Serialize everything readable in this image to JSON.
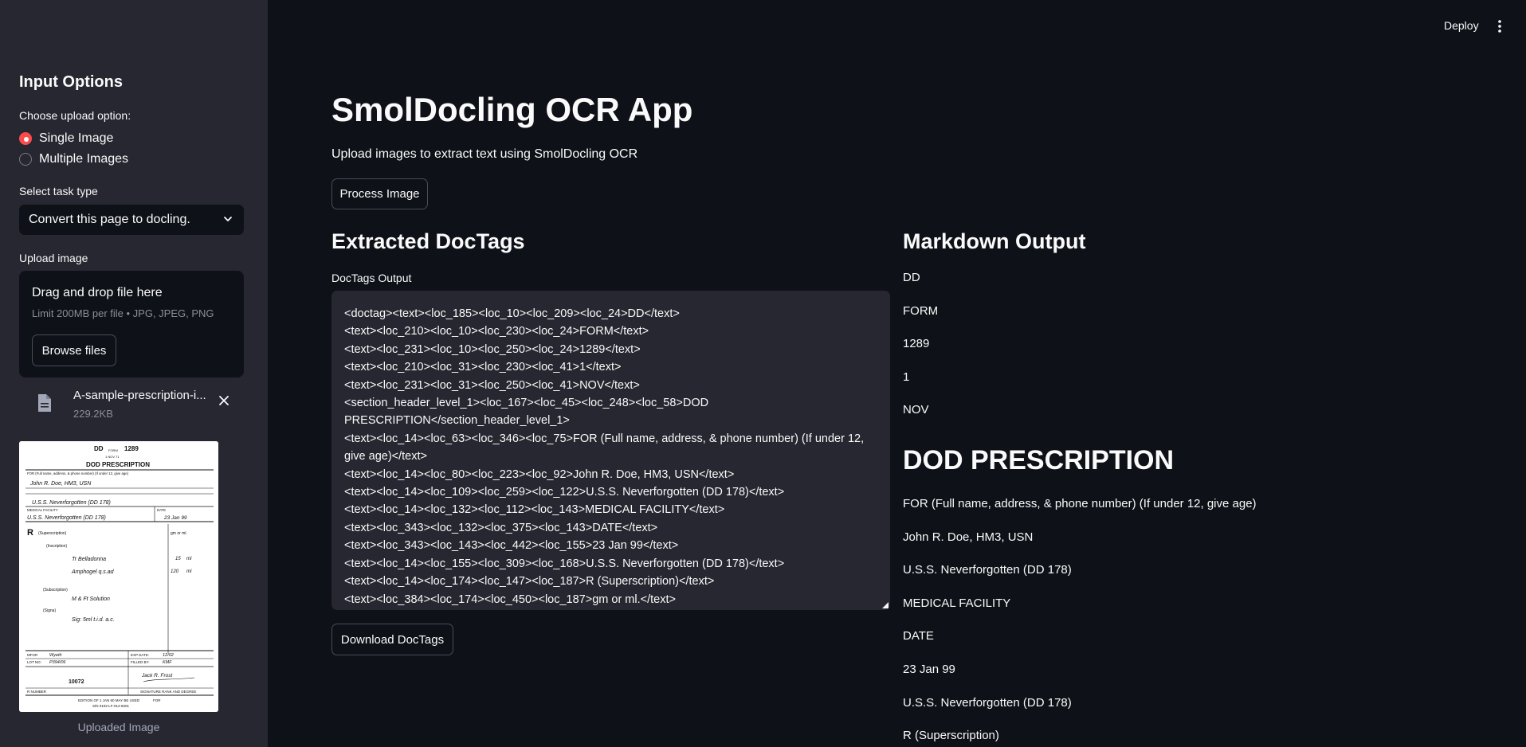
{
  "header": {
    "deploy_label": "Deploy",
    "menu_icon": "kebab-menu-icon"
  },
  "sidebar": {
    "heading": "Input Options",
    "upload_option_label": "Choose upload option:",
    "upload_options": [
      {
        "label": "Single Image",
        "selected": true
      },
      {
        "label": "Multiple Images",
        "selected": false
      }
    ],
    "task_type_label": "Select task type",
    "task_type_value": "Convert this page to docling.",
    "upload_label": "Upload image",
    "dropzone_title": "Drag and drop file here",
    "dropzone_limit": "Limit 200MB per file • JPG, JPEG, PNG",
    "browse_label": "Browse files",
    "file_name": "A-sample-prescription-i...",
    "file_size": "229.2KB",
    "image_caption": "Uploaded Image",
    "accent_color": "#ff4b4b",
    "thumbnail": {
      "form_no": "DD",
      "form_label": "FORM",
      "form_num": "1289",
      "date_line": "1 NOV 71",
      "title": "DOD PRESCRIPTION",
      "for_label": "FOR (Full name, address, & phone number) (If under 12, give age)",
      "name": "John R. Doe, HM3, USN",
      "ship": "U.S.S. Neverforgotten (DD 178)",
      "facility_label": "MEDICAL FACILITY",
      "date_label": "DATE",
      "facility": "U.S.S. Neverforgotten (DD 178)",
      "date": "23 Jan 99",
      "rx": "R",
      "superscription": "(Superscription)",
      "gm_ml": "gm or ml.",
      "inscription": "(Inscription)",
      "item1": "Tr Belladonna",
      "item1_qty": "15",
      "item1_unit": "ml",
      "item2": "Amphogel q.s.ad",
      "item2_qty": "120",
      "item2_unit": "ml",
      "subscription": "(Subscription)",
      "sub_text": "M & Ft Solution",
      "signa": "(Signa)",
      "signa_text": "Sig: 5ml t.i.d. a.c.",
      "mfgr_label": "MFGR",
      "mfgr": "Wyeth",
      "exp_label": "EXP DATE:",
      "exp": "12/02",
      "lot_label": "LOT NO:",
      "lot": "P394/06",
      "filled_label": "FILLED BY:",
      "filled": "KMF",
      "rx_number_label": "R NUMBER",
      "rx_number": "10072",
      "sig_label": "SIGNATURE RANK AND DEGREE",
      "signature": "Jack R. Frost",
      "edition": "EDITION OF 1 JAN 60 MAY BE USED",
      "sn": "S/N 0102-LF-012-8201",
      "for_word": "FOR"
    }
  },
  "main": {
    "title": "SmolDocling OCR App",
    "subtitle": "Upload images to extract text using SmolDocling OCR",
    "process_button": "Process Image",
    "doctags_heading": "Extracted DocTags",
    "doctags_label": "DocTags Output",
    "doctags_lines": [
      "<doctag><text><loc_185><loc_10><loc_209><loc_24>DD</text>",
      "<text><loc_210><loc_10><loc_230><loc_24>FORM</text>",
      "<text><loc_231><loc_10><loc_250><loc_24>1289</text>",
      "<text><loc_210><loc_31><loc_230><loc_41>1</text>",
      "<text><loc_231><loc_31><loc_250><loc_41>NOV</text>",
      "<section_header_level_1><loc_167><loc_45><loc_248><loc_58>DOD",
      "PRESCRIPTION</section_header_level_1>",
      "<text><loc_14><loc_63><loc_346><loc_75>FOR (Full name, address, & phone number) (If under 12,",
      "give age)</text>",
      "<text><loc_14><loc_80><loc_223><loc_92>John R. Doe, HM3, USN</text>",
      "<text><loc_14><loc_109><loc_259><loc_122>U.S.S. Neverforgotten (DD 178)</text>",
      "<text><loc_14><loc_132><loc_112><loc_143>MEDICAL FACILITY</text>",
      "<text><loc_343><loc_132><loc_375><loc_143>DATE</text>",
      "<text><loc_343><loc_143><loc_442><loc_155>23 Jan 99</text>",
      "<text><loc_14><loc_155><loc_309><loc_168>U.S.S. Neverforgotten (DD 178)</text>",
      "<text><loc_14><loc_174><loc_147><loc_187>R (Superscription)</text>",
      "<text><loc_384><loc_174><loc_450><loc_187>gm or ml.</text>"
    ],
    "download_button": "Download DocTags",
    "markdown_heading": "Markdown Output",
    "markdown_items": [
      {
        "type": "p",
        "text": "DD"
      },
      {
        "type": "p",
        "text": "FORM"
      },
      {
        "type": "p",
        "text": "1289"
      },
      {
        "type": "p",
        "text": "1"
      },
      {
        "type": "p",
        "text": "NOV"
      },
      {
        "type": "h1",
        "text": "DOD PRESCRIPTION"
      },
      {
        "type": "p",
        "text": "FOR (Full name, address, & phone number) (If under 12, give age)"
      },
      {
        "type": "p",
        "text": "John R. Doe, HM3, USN"
      },
      {
        "type": "p",
        "text": "U.S.S. Neverforgotten (DD 178)"
      },
      {
        "type": "p",
        "text": "MEDICAL FACILITY"
      },
      {
        "type": "p",
        "text": "DATE"
      },
      {
        "type": "p",
        "text": "23 Jan 99"
      },
      {
        "type": "p",
        "text": "U.S.S. Neverforgotten (DD 178)"
      },
      {
        "type": "p",
        "text": "R (Superscription)"
      }
    ]
  }
}
